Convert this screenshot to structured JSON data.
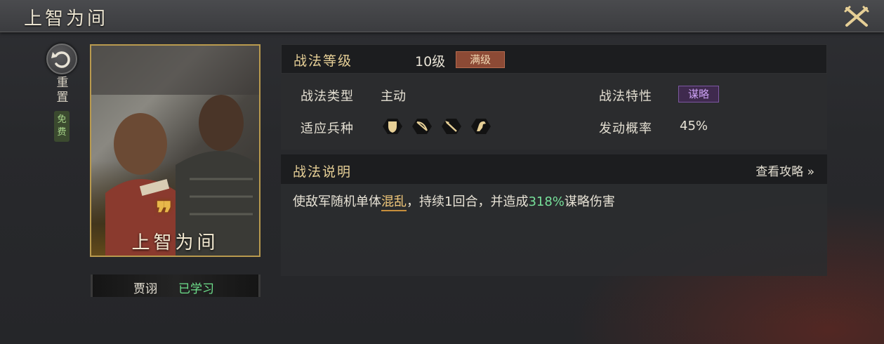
{
  "window": {
    "title": "上智为间"
  },
  "side": {
    "reset_label": "重置",
    "free_label": "免费"
  },
  "card": {
    "name": "上智为间",
    "quote_mark": "❞"
  },
  "owner": {
    "name": "贾诩",
    "status": "已学习"
  },
  "level": {
    "label": "战法等级",
    "value": "10级",
    "max_badge": "满级"
  },
  "stats": {
    "type_label": "战法类型",
    "type_value": "主动",
    "trait_label": "战法特性",
    "trait_value": "谋略",
    "troops_label": "适应兵种",
    "troops": [
      "shield-icon",
      "bow-icon",
      "spear-icon",
      "horse-icon"
    ],
    "rate_label": "发动概率",
    "rate_value": "45%"
  },
  "description": {
    "label": "战法说明",
    "guide_link": "查看攻略 »",
    "part1": "使敌军随机单体",
    "keyword": "混乱",
    "part2": "，持续1回合，并造成",
    "percent": "318%",
    "part3": "谋略伤害"
  },
  "colors": {
    "gold": "#e6cf96",
    "green": "#77e09a",
    "purple": "#c99ef0",
    "max_badge": "#8c4a35"
  }
}
